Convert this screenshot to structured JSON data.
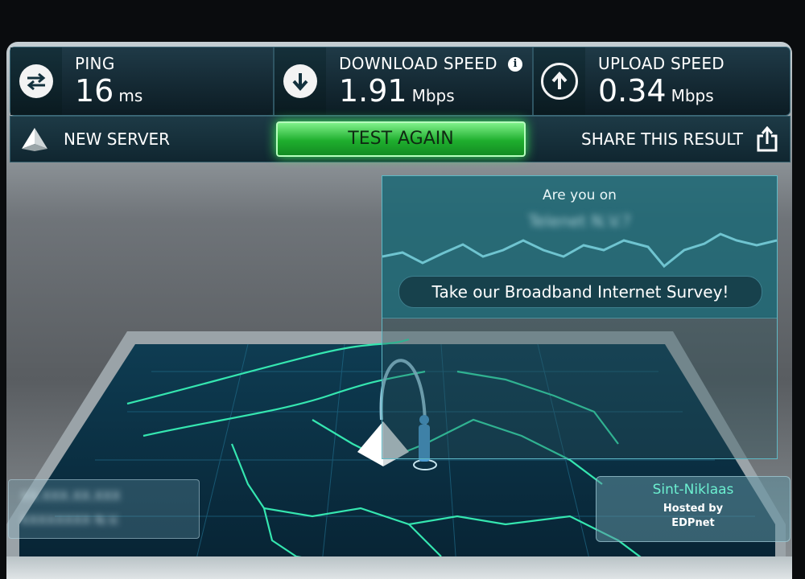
{
  "stats": {
    "ping": {
      "label": "PING",
      "value": "16",
      "unit": "ms",
      "icon": "ping-arrows-icon"
    },
    "download": {
      "label": "DOWNLOAD SPEED",
      "value": "1.91",
      "unit": "Mbps",
      "icon": "download-arrow-icon",
      "info": "i"
    },
    "upload": {
      "label": "UPLOAD SPEED",
      "value": "0.34",
      "unit": "Mbps",
      "icon": "upload-arrow-icon"
    }
  },
  "actions": {
    "new_server": "NEW SERVER",
    "test_again": "TEST AGAIN",
    "share": "SHARE THIS RESULT"
  },
  "survey": {
    "question": "Are you on",
    "isp_blurred": "Telenet N.V.?",
    "button": "Take our Broadband Internet Survey!"
  },
  "client": {
    "ip_blurred": "XX.XXX.XX.XXX",
    "isp_blurred": "XXXXXXXX N.V."
  },
  "server": {
    "city": "Sint-Niklaas",
    "hosted_line1": "Hosted by",
    "hosted_line2": "EDPnet"
  },
  "colors": {
    "accent_green": "#2ecc40",
    "map_line": "#35e6b0",
    "panel": "#1b6a76"
  }
}
